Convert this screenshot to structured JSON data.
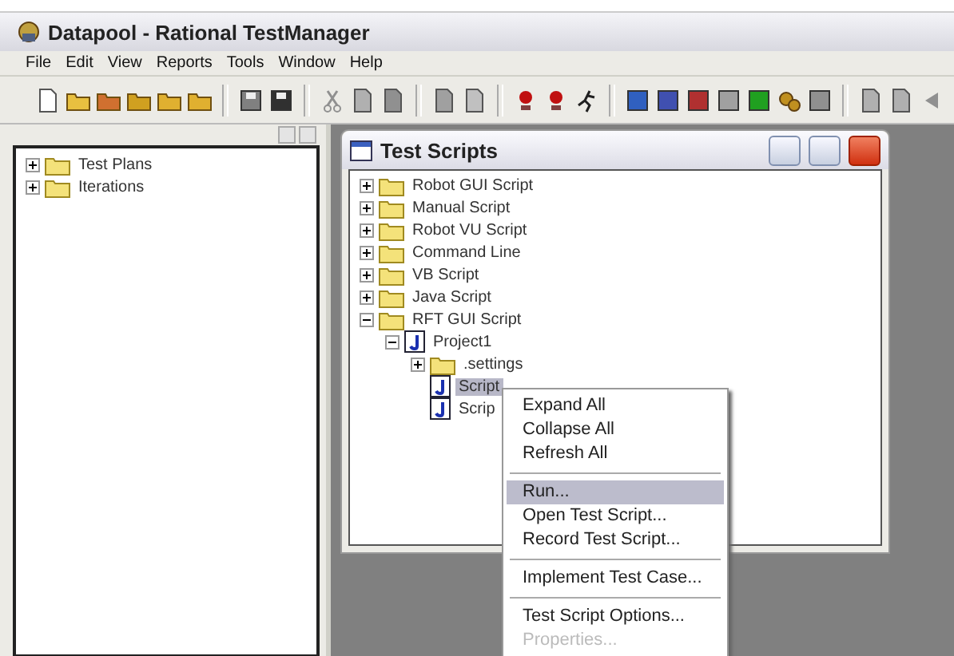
{
  "window": {
    "title": "Datapool - Rational TestManager"
  },
  "menu_bar": [
    "File",
    "Edit",
    "View",
    "Reports",
    "Tools",
    "Window",
    "Help"
  ],
  "left_pane": {
    "tree": [
      {
        "label": "Test Plans",
        "kind": "folder",
        "expanded": false
      },
      {
        "label": "Iterations",
        "kind": "folder",
        "expanded": false
      }
    ]
  },
  "test_scripts_window": {
    "title": "Test Scripts",
    "tree": [
      {
        "label": "Robot GUI Script",
        "kind": "folder",
        "expanded": false
      },
      {
        "label": "Manual Script",
        "kind": "folder",
        "expanded": false
      },
      {
        "label": "Robot VU Script",
        "kind": "folder",
        "expanded": false
      },
      {
        "label": "Command Line",
        "kind": "folder",
        "expanded": false
      },
      {
        "label": "VB Script",
        "kind": "folder",
        "expanded": false
      },
      {
        "label": "Java Script",
        "kind": "folder",
        "expanded": false
      },
      {
        "label": "RFT GUI Script",
        "kind": "folder",
        "expanded": true,
        "children": [
          {
            "label": "Project1",
            "kind": "script",
            "expanded": true,
            "children": [
              {
                "label": ".settings",
                "kind": "folder",
                "expanded": false
              },
              {
                "label": "Script",
                "kind": "script",
                "selected": true
              },
              {
                "label": "Scrip",
                "kind": "script",
                "selected": false
              }
            ]
          }
        ]
      }
    ]
  },
  "context_menu": {
    "items": [
      {
        "kind": "item",
        "label": "Expand All",
        "selected": false,
        "disabled": false
      },
      {
        "kind": "item",
        "label": "Collapse All",
        "selected": false,
        "disabled": false
      },
      {
        "kind": "item",
        "label": "Refresh All",
        "selected": false,
        "disabled": false
      },
      {
        "kind": "separator"
      },
      {
        "kind": "item",
        "label": "Run...",
        "selected": true,
        "disabled": false
      },
      {
        "kind": "item",
        "label": "Open Test Script...",
        "selected": false,
        "disabled": false
      },
      {
        "kind": "item",
        "label": "Record Test Script...",
        "selected": false,
        "disabled": false
      },
      {
        "kind": "separator"
      },
      {
        "kind": "item",
        "label": "Implement Test Case...",
        "selected": false,
        "disabled": false
      },
      {
        "kind": "separator"
      },
      {
        "kind": "item",
        "label": "Test Script Options...",
        "selected": false,
        "disabled": false
      },
      {
        "kind": "item",
        "label": "Properties...",
        "selected": false,
        "disabled": true
      }
    ]
  }
}
